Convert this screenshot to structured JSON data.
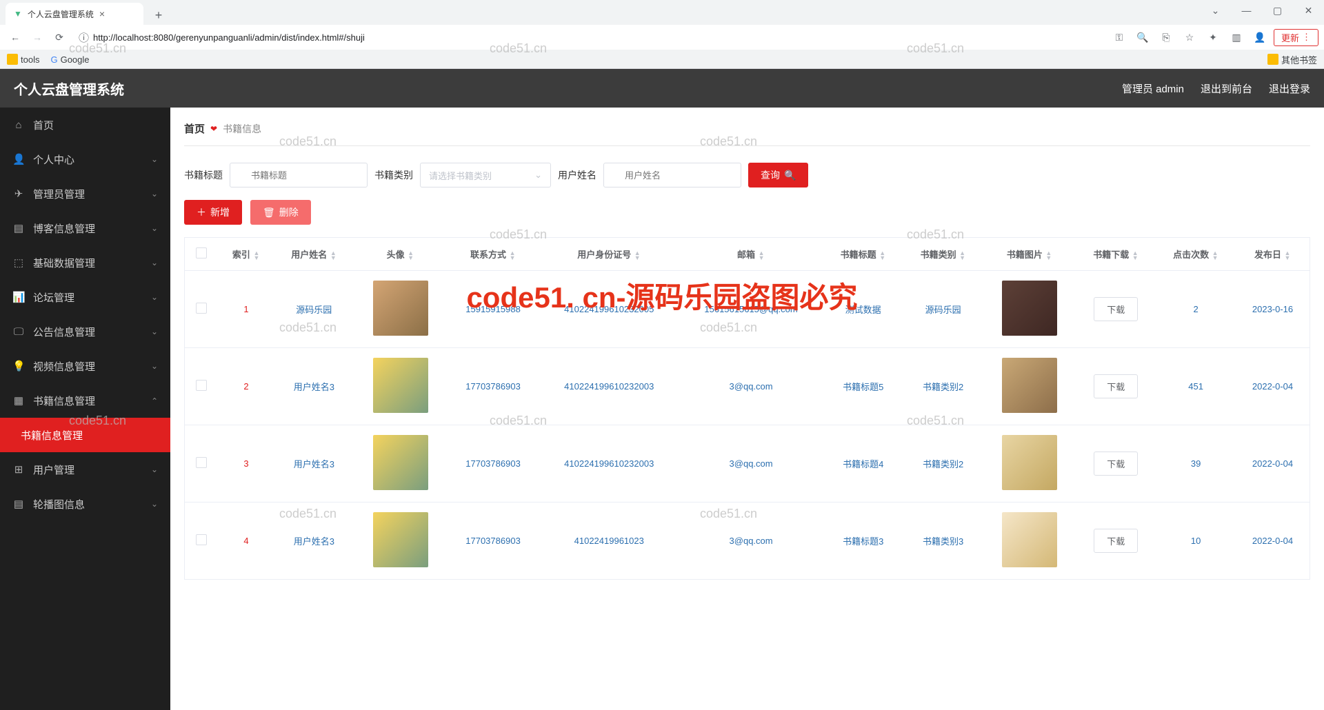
{
  "browser": {
    "tab_title": "个人云盘管理系统",
    "url": "http://localhost:8080/gerenyunpanguanli/admin/dist/index.html#/shuji",
    "update_label": "更新",
    "bookmarks": {
      "tools": "tools",
      "google": "Google",
      "other": "其他书签"
    }
  },
  "header": {
    "title": "个人云盘管理系统",
    "user_label": "管理员 admin",
    "exit_front": "退出到前台",
    "logout": "退出登录"
  },
  "sidebar": {
    "items": [
      {
        "icon": "⌂",
        "label": "首页",
        "has_children": false
      },
      {
        "icon": "👤",
        "label": "个人中心",
        "has_children": true
      },
      {
        "icon": "✈",
        "label": "管理员管理",
        "has_children": true
      },
      {
        "icon": "▤",
        "label": "博客信息管理",
        "has_children": true
      },
      {
        "icon": "⬚",
        "label": "基础数据管理",
        "has_children": true
      },
      {
        "icon": "📊",
        "label": "论坛管理",
        "has_children": true
      },
      {
        "icon": "🖵",
        "label": "公告信息管理",
        "has_children": true
      },
      {
        "icon": "💡",
        "label": "视频信息管理",
        "has_children": true
      },
      {
        "icon": "▦",
        "label": "书籍信息管理",
        "has_children": true,
        "expanded": true
      },
      {
        "icon": "⊞",
        "label": "用户管理",
        "has_children": true
      },
      {
        "icon": "▤",
        "label": "轮播图信息",
        "has_children": true
      }
    ],
    "submenu_active": "书籍信息管理"
  },
  "breadcrumb": {
    "home": "首页",
    "current": "书籍信息"
  },
  "search": {
    "title_label": "书籍标题",
    "title_placeholder": "书籍标题",
    "type_label": "书籍类别",
    "type_placeholder": "请选择书籍类别",
    "user_label": "用户姓名",
    "user_placeholder": "用户姓名",
    "query_btn": "查询"
  },
  "actions": {
    "add": "新增",
    "delete": "删除"
  },
  "table": {
    "cols": [
      "",
      "索引",
      "用户姓名",
      "头像",
      "联系方式",
      "用户身份证号",
      "邮箱",
      "书籍标题",
      "书籍类别",
      "书籍图片",
      "书籍下载",
      "点击次数",
      "发布日"
    ],
    "rows": [
      {
        "idx": "1",
        "name": "源码乐园",
        "phone": "15915915988",
        "idcard": "410224199610232005",
        "email": "15615615615@qq.com",
        "title": "测试数据",
        "type": "源码乐园",
        "dl": "下载",
        "clicks": "2",
        "date": "2023-0-16"
      },
      {
        "idx": "2",
        "name": "用户姓名3",
        "phone": "17703786903",
        "idcard": "410224199610232003",
        "email": "3@qq.com",
        "title": "书籍标题5",
        "type": "书籍类别2",
        "dl": "下载",
        "clicks": "451",
        "date": "2022-0-04"
      },
      {
        "idx": "3",
        "name": "用户姓名3",
        "phone": "17703786903",
        "idcard": "410224199610232003",
        "email": "3@qq.com",
        "title": "书籍标题4",
        "type": "书籍类别2",
        "dl": "下载",
        "clicks": "39",
        "date": "2022-0-04"
      },
      {
        "idx": "4",
        "name": "用户姓名3",
        "phone": "17703786903",
        "idcard": "41022419961023",
        "email": "3@qq.com",
        "title": "书籍标题3",
        "type": "书籍类别3",
        "dl": "下载",
        "clicks": "10",
        "date": "2022-0-04"
      }
    ]
  },
  "watermark": {
    "small": "code51.cn",
    "big": "code51. cn-源码乐园盗图必究"
  }
}
